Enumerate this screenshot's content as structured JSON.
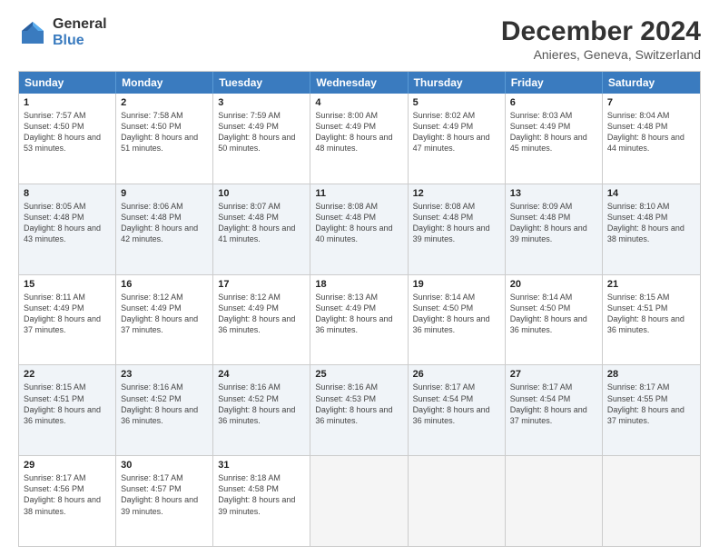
{
  "logo": {
    "general": "General",
    "blue": "Blue"
  },
  "header": {
    "title": "December 2024",
    "subtitle": "Anieres, Geneva, Switzerland"
  },
  "weekdays": [
    "Sunday",
    "Monday",
    "Tuesday",
    "Wednesday",
    "Thursday",
    "Friday",
    "Saturday"
  ],
  "rows": [
    {
      "alt": false,
      "cells": [
        {
          "day": "1",
          "sunrise": "Sunrise: 7:57 AM",
          "sunset": "Sunset: 4:50 PM",
          "daylight": "Daylight: 8 hours and 53 minutes."
        },
        {
          "day": "2",
          "sunrise": "Sunrise: 7:58 AM",
          "sunset": "Sunset: 4:50 PM",
          "daylight": "Daylight: 8 hours and 51 minutes."
        },
        {
          "day": "3",
          "sunrise": "Sunrise: 7:59 AM",
          "sunset": "Sunset: 4:49 PM",
          "daylight": "Daylight: 8 hours and 50 minutes."
        },
        {
          "day": "4",
          "sunrise": "Sunrise: 8:00 AM",
          "sunset": "Sunset: 4:49 PM",
          "daylight": "Daylight: 8 hours and 48 minutes."
        },
        {
          "day": "5",
          "sunrise": "Sunrise: 8:02 AM",
          "sunset": "Sunset: 4:49 PM",
          "daylight": "Daylight: 8 hours and 47 minutes."
        },
        {
          "day": "6",
          "sunrise": "Sunrise: 8:03 AM",
          "sunset": "Sunset: 4:49 PM",
          "daylight": "Daylight: 8 hours and 45 minutes."
        },
        {
          "day": "7",
          "sunrise": "Sunrise: 8:04 AM",
          "sunset": "Sunset: 4:48 PM",
          "daylight": "Daylight: 8 hours and 44 minutes."
        }
      ]
    },
    {
      "alt": true,
      "cells": [
        {
          "day": "8",
          "sunrise": "Sunrise: 8:05 AM",
          "sunset": "Sunset: 4:48 PM",
          "daylight": "Daylight: 8 hours and 43 minutes."
        },
        {
          "day": "9",
          "sunrise": "Sunrise: 8:06 AM",
          "sunset": "Sunset: 4:48 PM",
          "daylight": "Daylight: 8 hours and 42 minutes."
        },
        {
          "day": "10",
          "sunrise": "Sunrise: 8:07 AM",
          "sunset": "Sunset: 4:48 PM",
          "daylight": "Daylight: 8 hours and 41 minutes."
        },
        {
          "day": "11",
          "sunrise": "Sunrise: 8:08 AM",
          "sunset": "Sunset: 4:48 PM",
          "daylight": "Daylight: 8 hours and 40 minutes."
        },
        {
          "day": "12",
          "sunrise": "Sunrise: 8:08 AM",
          "sunset": "Sunset: 4:48 PM",
          "daylight": "Daylight: 8 hours and 39 minutes."
        },
        {
          "day": "13",
          "sunrise": "Sunrise: 8:09 AM",
          "sunset": "Sunset: 4:48 PM",
          "daylight": "Daylight: 8 hours and 39 minutes."
        },
        {
          "day": "14",
          "sunrise": "Sunrise: 8:10 AM",
          "sunset": "Sunset: 4:48 PM",
          "daylight": "Daylight: 8 hours and 38 minutes."
        }
      ]
    },
    {
      "alt": false,
      "cells": [
        {
          "day": "15",
          "sunrise": "Sunrise: 8:11 AM",
          "sunset": "Sunset: 4:49 PM",
          "daylight": "Daylight: 8 hours and 37 minutes."
        },
        {
          "day": "16",
          "sunrise": "Sunrise: 8:12 AM",
          "sunset": "Sunset: 4:49 PM",
          "daylight": "Daylight: 8 hours and 37 minutes."
        },
        {
          "day": "17",
          "sunrise": "Sunrise: 8:12 AM",
          "sunset": "Sunset: 4:49 PM",
          "daylight": "Daylight: 8 hours and 36 minutes."
        },
        {
          "day": "18",
          "sunrise": "Sunrise: 8:13 AM",
          "sunset": "Sunset: 4:49 PM",
          "daylight": "Daylight: 8 hours and 36 minutes."
        },
        {
          "day": "19",
          "sunrise": "Sunrise: 8:14 AM",
          "sunset": "Sunset: 4:50 PM",
          "daylight": "Daylight: 8 hours and 36 minutes."
        },
        {
          "day": "20",
          "sunrise": "Sunrise: 8:14 AM",
          "sunset": "Sunset: 4:50 PM",
          "daylight": "Daylight: 8 hours and 36 minutes."
        },
        {
          "day": "21",
          "sunrise": "Sunrise: 8:15 AM",
          "sunset": "Sunset: 4:51 PM",
          "daylight": "Daylight: 8 hours and 36 minutes."
        }
      ]
    },
    {
      "alt": true,
      "cells": [
        {
          "day": "22",
          "sunrise": "Sunrise: 8:15 AM",
          "sunset": "Sunset: 4:51 PM",
          "daylight": "Daylight: 8 hours and 36 minutes."
        },
        {
          "day": "23",
          "sunrise": "Sunrise: 8:16 AM",
          "sunset": "Sunset: 4:52 PM",
          "daylight": "Daylight: 8 hours and 36 minutes."
        },
        {
          "day": "24",
          "sunrise": "Sunrise: 8:16 AM",
          "sunset": "Sunset: 4:52 PM",
          "daylight": "Daylight: 8 hours and 36 minutes."
        },
        {
          "day": "25",
          "sunrise": "Sunrise: 8:16 AM",
          "sunset": "Sunset: 4:53 PM",
          "daylight": "Daylight: 8 hours and 36 minutes."
        },
        {
          "day": "26",
          "sunrise": "Sunrise: 8:17 AM",
          "sunset": "Sunset: 4:54 PM",
          "daylight": "Daylight: 8 hours and 36 minutes."
        },
        {
          "day": "27",
          "sunrise": "Sunrise: 8:17 AM",
          "sunset": "Sunset: 4:54 PM",
          "daylight": "Daylight: 8 hours and 37 minutes."
        },
        {
          "day": "28",
          "sunrise": "Sunrise: 8:17 AM",
          "sunset": "Sunset: 4:55 PM",
          "daylight": "Daylight: 8 hours and 37 minutes."
        }
      ]
    },
    {
      "alt": false,
      "cells": [
        {
          "day": "29",
          "sunrise": "Sunrise: 8:17 AM",
          "sunset": "Sunset: 4:56 PM",
          "daylight": "Daylight: 8 hours and 38 minutes."
        },
        {
          "day": "30",
          "sunrise": "Sunrise: 8:17 AM",
          "sunset": "Sunset: 4:57 PM",
          "daylight": "Daylight: 8 hours and 39 minutes."
        },
        {
          "day": "31",
          "sunrise": "Sunrise: 8:18 AM",
          "sunset": "Sunset: 4:58 PM",
          "daylight": "Daylight: 8 hours and 39 minutes."
        },
        {
          "day": "",
          "sunrise": "",
          "sunset": "",
          "daylight": ""
        },
        {
          "day": "",
          "sunrise": "",
          "sunset": "",
          "daylight": ""
        },
        {
          "day": "",
          "sunrise": "",
          "sunset": "",
          "daylight": ""
        },
        {
          "day": "",
          "sunrise": "",
          "sunset": "",
          "daylight": ""
        }
      ]
    }
  ]
}
